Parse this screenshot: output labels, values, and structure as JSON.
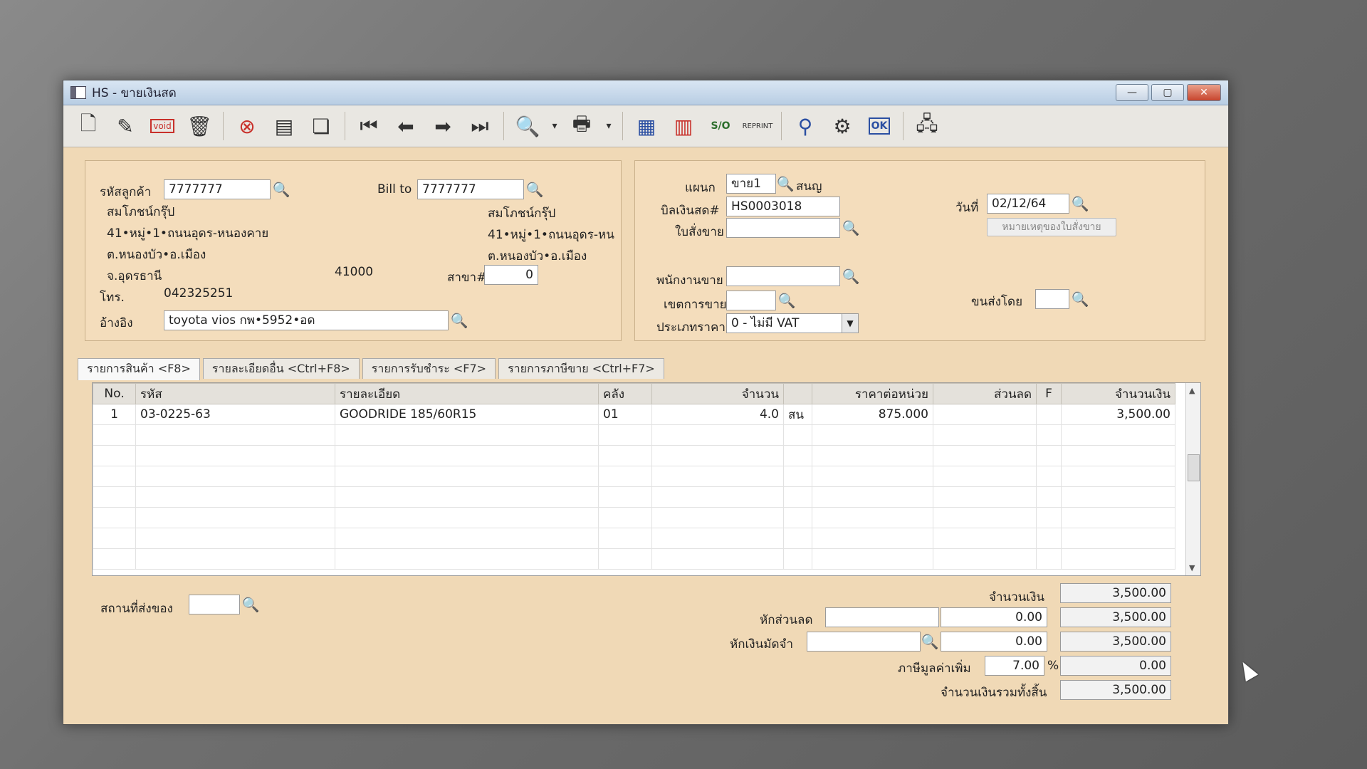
{
  "window": {
    "title": "HS - ขายเงินสด",
    "buttons": {
      "minimize": "—",
      "maximize": "▢",
      "close": "✕"
    }
  },
  "toolbar": {
    "icons": [
      "new-icon",
      "edit-icon",
      "void-icon",
      "delete-icon",
      "cancel-icon",
      "save-icon",
      "copy-icon",
      "first-icon",
      "prev-icon",
      "next-icon",
      "last-icon",
      "find-icon",
      "print-icon",
      "report-icon",
      "report2-icon",
      "so-icon",
      "reprint-icon",
      "approve-icon",
      "tools-icon",
      "ok-icon",
      "network-icon"
    ],
    "void_text": "void",
    "so_text": "S/O",
    "reprint_text": "REPRINT",
    "ok_text": "OK"
  },
  "customer": {
    "code_label": "รหัสลูกค้า",
    "code_value": "7777777",
    "name": "สมโภชน์กรุ๊ป",
    "address1": "41•หมู่•1•ถนนอุดร-หนองคาย",
    "address2": "ต.หนองบัว•อ.เมือง",
    "province": "จ.อุดรธานี",
    "postcode": "41000",
    "phone_label": "โทร.",
    "phone": "042325251",
    "ref_label": "อ้างอิง",
    "ref_value": "toyota vios กพ•5952•อด"
  },
  "billto": {
    "label": "Bill to",
    "code": "7777777",
    "name": "สมโภชน์กรุ๊ป",
    "address1": "41•หมู่•1•ถนนอุดร-หน",
    "address2": "ต.หนองบัว•อ.เมือง",
    "branch_label": "สาขา#",
    "branch_value": "0"
  },
  "doc": {
    "dept_label": "แผนก",
    "dept_value": "ขาย1",
    "dept_name": "สนญ",
    "bill_label": "บิลเงินสด#",
    "bill_value": "HS0003018",
    "so_label": "ใบสั่งขาย",
    "so_value": "",
    "date_label": "วันที่",
    "date_value": "02/12/64",
    "so_note_button": "หมายเหตุของใบสั่งขาย",
    "salesman_label": "พนักงานขาย",
    "salesman_value": "",
    "area_label": "เขตการขาย",
    "area_value": "",
    "ship_label": "ขนส่งโดย",
    "ship_value": "",
    "price_type_label": "ประเภทราคา",
    "price_type_value": "0 - ไม่มี VAT"
  },
  "tabs": [
    {
      "label": "รายการสินค้า <F8>"
    },
    {
      "label": "รายละเอียดอื่น <Ctrl+F8>"
    },
    {
      "label": "รายการรับชำระ <F7>"
    },
    {
      "label": "รายการภาษีขาย <Ctrl+F7>"
    }
  ],
  "grid": {
    "headers": [
      "No.",
      "รหัส",
      "รายละเอียด",
      "คลัง",
      "จำนวน",
      "",
      "ราคาต่อหน่วย",
      "ส่วนลด",
      "F",
      "จำนวนเงิน"
    ],
    "rows": [
      [
        "1",
        "03-0225-63",
        "GOODRIDE 185/60R15",
        "01",
        "4.0",
        "สน",
        "875.000",
        "",
        "",
        "3,500.00"
      ]
    ]
  },
  "footer": {
    "delivery_label": "สถานที่ส่งของ",
    "delivery_value": "",
    "amount_label": "จำนวนเงิน",
    "amount_value": "3,500.00",
    "discount_label": "หักส่วนลด",
    "discount_input": "",
    "discount_amount": "0.00",
    "discount_total": "3,500.00",
    "deposit_label": "หักเงินมัดจำ",
    "deposit_input": "",
    "deposit_amount": "0.00",
    "deposit_total": "3,500.00",
    "vat_label": "ภาษีมูลค่าเพิ่ม",
    "vat_rate": "7.00",
    "vat_pct": "%",
    "vat_amount": "0.00",
    "grand_label": "จำนวนเงินรวมทั้งสิ้น",
    "grand_value": "3,500.00"
  }
}
